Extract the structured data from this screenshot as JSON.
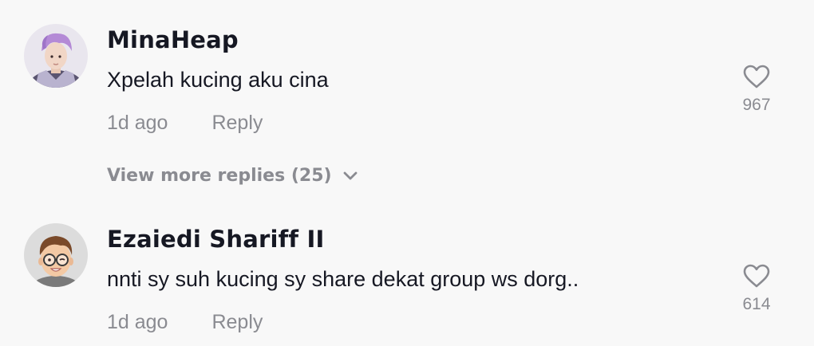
{
  "comments": [
    {
      "username": "MinaHeap",
      "text": "Xpelah kucing aku cina",
      "time": "1d ago",
      "reply_label": "Reply",
      "likes": "967",
      "avatar_icon": "user-photo-avatar"
    },
    {
      "username": "Ezaiedi Shariff II",
      "text": "nnti sy suh kucing sy share dekat group ws dorg..",
      "time": "1d ago",
      "reply_label": "Reply",
      "likes": "614",
      "avatar_icon": "memoji-avatar"
    }
  ],
  "view_more": {
    "label": "View more replies (25)",
    "icon": "chevron-down-icon"
  },
  "colors": {
    "background": "#f8f8f8",
    "primary_text": "#161823",
    "secondary_text": "#8a8b91"
  }
}
